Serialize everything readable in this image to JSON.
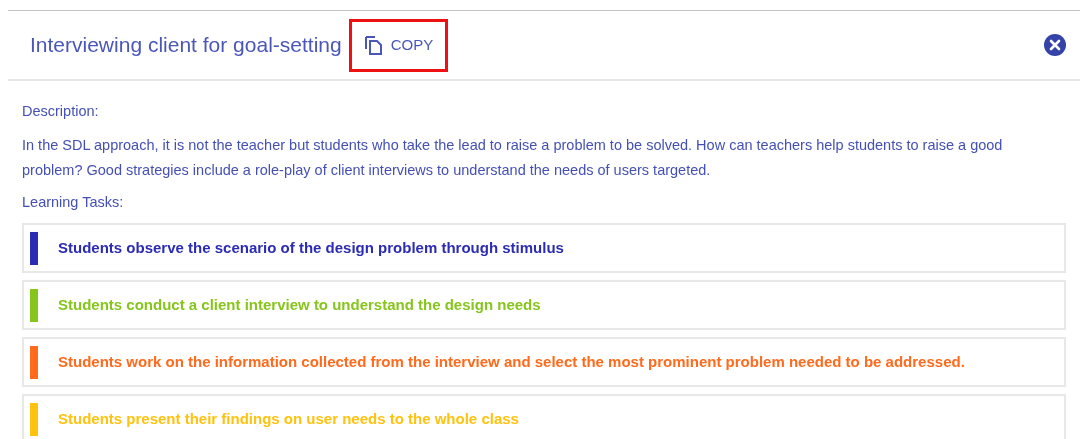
{
  "dialog": {
    "title": "Interviewing client for goal-setting",
    "copy_button": "COPY",
    "copy_highlighted": true
  },
  "description_label": "Description:",
  "description": "In the SDL approach, it is not the teacher but students who take the lead to raise a problem to be solved. How can teachers help students to raise a good problem? Good strategies include a role-play of client interviews to understand the needs of users targeted.",
  "tasks_label": "Learning Tasks:",
  "tasks": [
    {
      "text": "Students observe the scenario of the design problem through stimulus",
      "color": "#2b2bb3"
    },
    {
      "text": "Students conduct a client interview to understand the design needs",
      "color": "#86c51c"
    },
    {
      "text": "Students work on the information collected from the interview and select the most prominent problem needed to be addressed.",
      "color": "#ff6a1c"
    },
    {
      "text": "Students present their findings on user needs to the whole class",
      "color": "#ffc20e"
    }
  ]
}
